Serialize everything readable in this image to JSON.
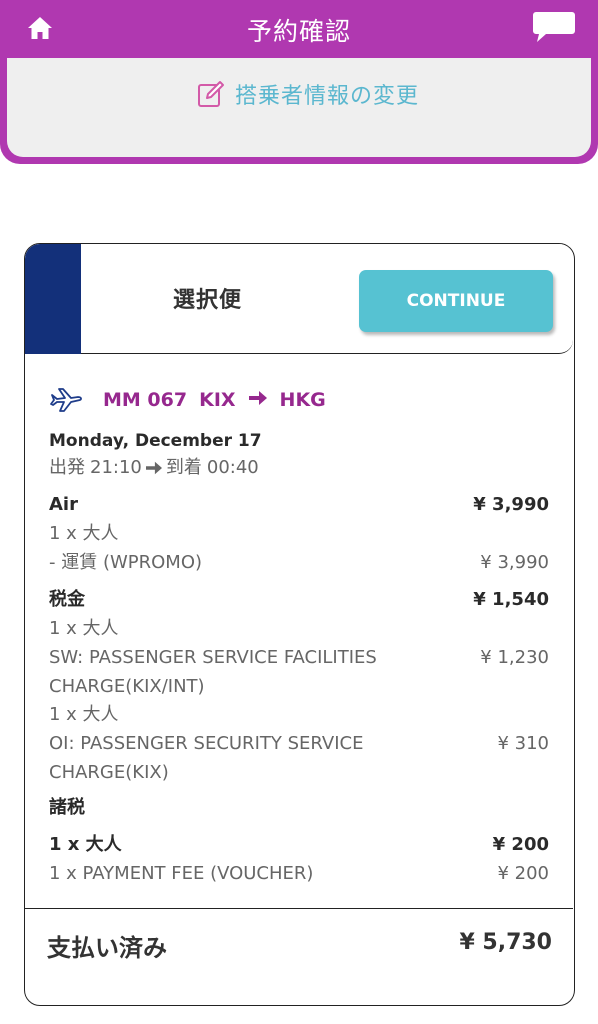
{
  "header": {
    "title": "予約確認",
    "home_icon": "home-icon",
    "chat_icon": "chat-bubble-icon",
    "color": "#b038b0"
  },
  "edit_passenger": {
    "label": "搭乗者情報の変更",
    "icon": "edit-icon"
  },
  "card": {
    "selected_label": "選択便",
    "continue_label": "CONTINUE",
    "flight": {
      "number": "MM 067",
      "origin": "KIX",
      "destination": "HKG"
    },
    "date": "Monday, December 17",
    "departure_label": "出発",
    "departure_time": "21:10",
    "arrival_label": "到着",
    "arrival_time": "00:40",
    "air": {
      "label": "Air",
      "amount": "¥ 3,990",
      "pax": "1 x 大人",
      "fare_label": "- 運賃 (WPROMO)",
      "fare_amount": "¥ 3,990"
    },
    "tax": {
      "label": "税金",
      "amount": "¥ 1,540",
      "pax1": "1 x 大人",
      "sw_line1": "SW: PASSENGER SERVICE FACILITIES",
      "sw_line2": "CHARGE(KIX/INT)",
      "sw_amount": "¥ 1,230",
      "pax2": "1 x 大人",
      "oi_line1": "OI: PASSENGER SECURITY SERVICE",
      "oi_line2": "CHARGE(KIX)",
      "oi_amount": "¥ 310"
    },
    "fees": {
      "label": "諸税",
      "pax_label": "1 x 大人",
      "pax_amount": "¥ 200",
      "payment_label": "1 x PAYMENT FEE (VOUCHER)",
      "payment_amount": "¥ 200"
    },
    "total": {
      "label": "支払い済み",
      "amount": "¥ 5,730"
    },
    "colors": {
      "stripe": "#13307a",
      "button": "#56c2d2",
      "flight_text": "#96288e",
      "link": "#5bb7cf"
    }
  }
}
